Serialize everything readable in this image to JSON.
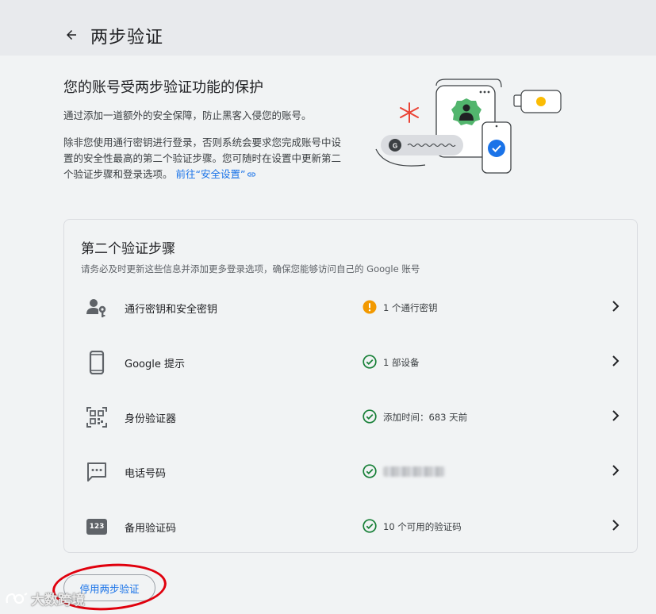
{
  "header": {
    "title": "两步验证"
  },
  "intro": {
    "heading": "您的账号受两步验证功能的保护",
    "para1": "通过添加一道额外的安全保障，防止黑客入侵您的账号。",
    "para2": "除非您使用通行密钥进行登录，否则系统会要求您完成账号中设置的安全性最高的第二个验证步骤。您可随时在设置中更新第二个验证步骤和登录选项。",
    "link_label": "前往“安全设置”"
  },
  "steps": {
    "title": "第二个验证步骤",
    "subtitle": "请务必及时更新这些信息并添加更多登录选项，确保您能够访问自己的 Google 账号",
    "items": [
      {
        "label": "通行密钥和安全密钥",
        "icon": "person-key-icon",
        "status_icon": "warning-icon",
        "status": "1 个通行密钥"
      },
      {
        "label": "Google 提示",
        "icon": "phone-icon",
        "status_icon": "check-circle-icon",
        "status": "1 部设备"
      },
      {
        "label": "身份验证器",
        "icon": "qr-code-icon",
        "status_icon": "check-circle-icon",
        "status": "添加时间：683 天前"
      },
      {
        "label": "电话号码",
        "icon": "message-dots-icon",
        "status_icon": "check-circle-icon",
        "status": ""
      },
      {
        "label": "备用验证码",
        "icon": "123-icon",
        "status_icon": "check-circle-icon",
        "status": "10 个可用的验证码"
      }
    ]
  },
  "actions": {
    "disable_label": "停用两步验证"
  },
  "badges": {
    "backup_codes_icon_text": "123"
  },
  "watermark": {
    "text": "大数跨境"
  },
  "colors": {
    "accent": "#1a73e8",
    "success": "#188038",
    "warning": "#e37400",
    "annotation": "#e0000d"
  }
}
